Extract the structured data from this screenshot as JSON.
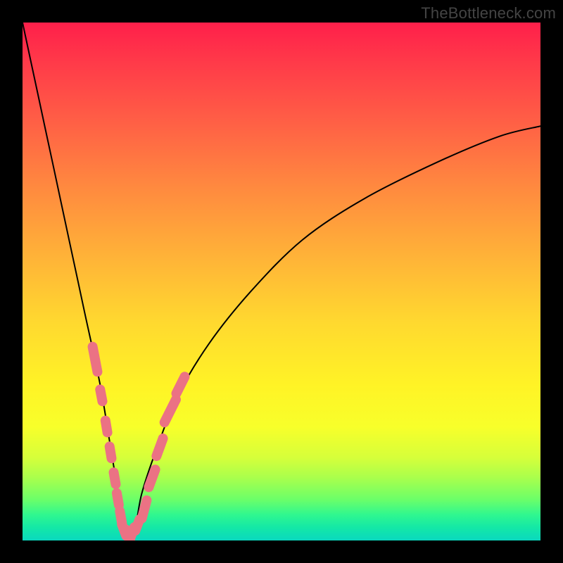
{
  "watermark": "TheBottleneck.com",
  "colors": {
    "page_bg": "#000000",
    "marker": "#eb7284",
    "curve": "#000000",
    "gradient_top": "#ff1f4a",
    "gradient_bottom": "#0ad8bf"
  },
  "chart_data": {
    "type": "line",
    "title": "",
    "xlabel": "",
    "ylabel": "",
    "xlim": [
      0,
      100
    ],
    "ylim": [
      0,
      100
    ],
    "grid": false,
    "legend": false,
    "curve": {
      "comment": "V-shaped bottleneck curve. y≈100 at x≈0, dips to y≈0 near x≈20, rises asymptotically toward y≈80 at x≈100.",
      "x": [
        0,
        3,
        6,
        9,
        12,
        15,
        17,
        18.5,
        20,
        21.5,
        23,
        26,
        30,
        36,
        44,
        54,
        66,
        80,
        92,
        100
      ],
      "y": [
        100,
        86,
        72,
        58,
        44,
        30,
        18,
        9,
        1,
        1,
        9,
        18,
        28,
        38,
        48,
        58,
        66,
        73,
        78,
        80
      ]
    },
    "markers": {
      "comment": "Highlighted sample points near the trough of the curve (pink pill-shaped markers).",
      "points": [
        {
          "x": 14.0,
          "y": 35.0,
          "len": 4
        },
        {
          "x": 15.2,
          "y": 28.0,
          "len": 2
        },
        {
          "x": 16.2,
          "y": 22.0,
          "len": 2
        },
        {
          "x": 17.0,
          "y": 17.0,
          "len": 2
        },
        {
          "x": 17.8,
          "y": 12.0,
          "len": 2
        },
        {
          "x": 18.4,
          "y": 8.0,
          "len": 2
        },
        {
          "x": 19.0,
          "y": 4.5,
          "len": 2
        },
        {
          "x": 19.6,
          "y": 2.0,
          "len": 2
        },
        {
          "x": 20.4,
          "y": 1.0,
          "len": 2
        },
        {
          "x": 21.2,
          "y": 1.5,
          "len": 2
        },
        {
          "x": 22.2,
          "y": 3.0,
          "len": 2
        },
        {
          "x": 23.5,
          "y": 6.0,
          "len": 3
        },
        {
          "x": 25.0,
          "y": 12.0,
          "len": 3
        },
        {
          "x": 26.5,
          "y": 18.0,
          "len": 3
        },
        {
          "x": 28.5,
          "y": 25.0,
          "len": 4
        },
        {
          "x": 30.5,
          "y": 30.0,
          "len": 3
        }
      ]
    }
  }
}
